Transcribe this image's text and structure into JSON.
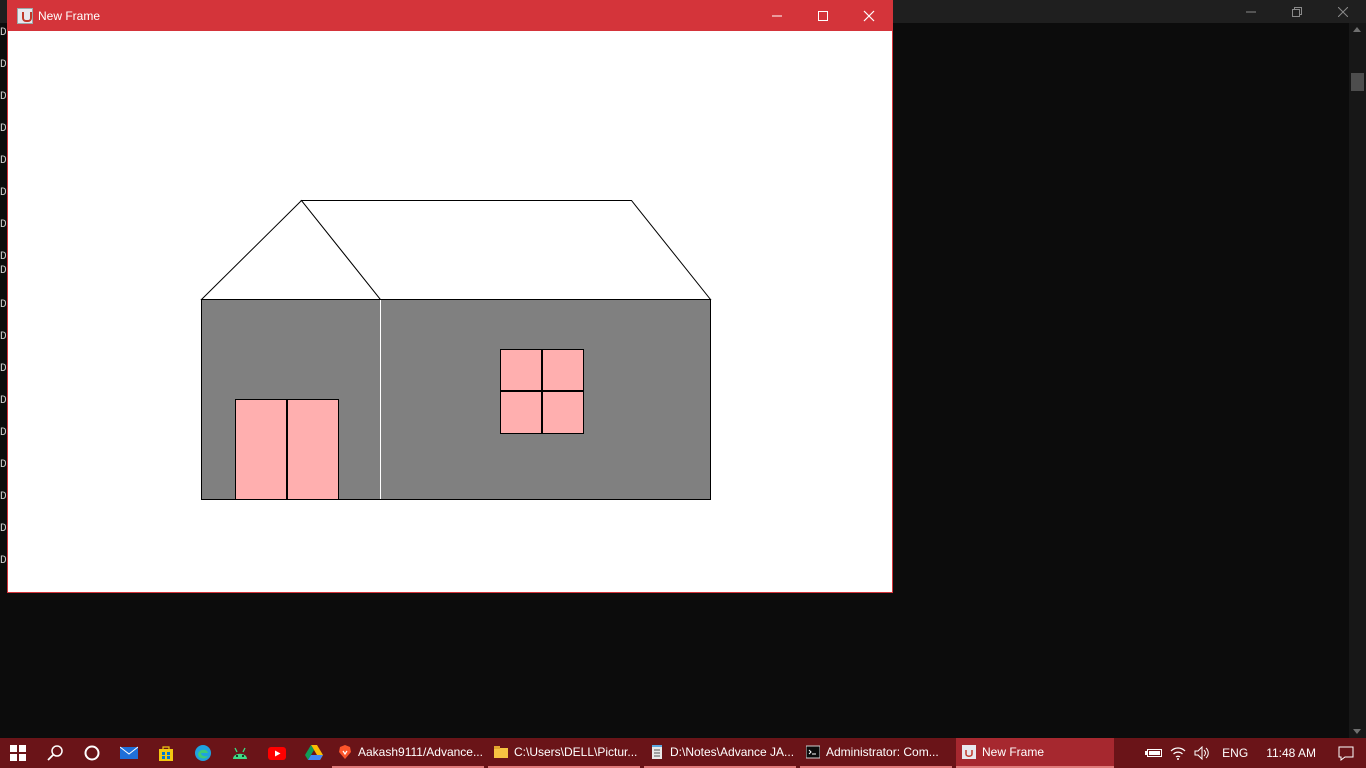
{
  "console": {
    "line_prefix": "D",
    "line_count": 18
  },
  "frame": {
    "title": "New Frame",
    "drawing": {
      "outline_color": "#000000",
      "wall_color": "#808080",
      "door_window_color": "#ffafaf",
      "background_color": "#ffffff"
    }
  },
  "taskbar": {
    "pinned_icons": [
      "windows-start-icon",
      "search-icon",
      "cortana-icon",
      "mail-icon",
      "store-icon",
      "edge-icon",
      "android-studio-icon",
      "youtube-icon",
      "google-drive-icon"
    ],
    "apps": [
      {
        "label": "Aakash9111/Advance...",
        "icon": "brave-browser-icon",
        "active": false
      },
      {
        "label": "C:\\Users\\DELL\\Pictur...",
        "icon": "folder-icon",
        "active": false
      },
      {
        "label": "D:\\Notes\\Advance JA...",
        "icon": "notepad-icon",
        "active": false
      },
      {
        "label": "Administrator: Com...",
        "icon": "cmd-icon",
        "active": false
      },
      {
        "label": "New Frame",
        "icon": "java-icon",
        "active": true
      }
    ],
    "tray": {
      "language": "ENG",
      "time": "11:48 AM"
    },
    "accent_color": "#6a1418"
  }
}
